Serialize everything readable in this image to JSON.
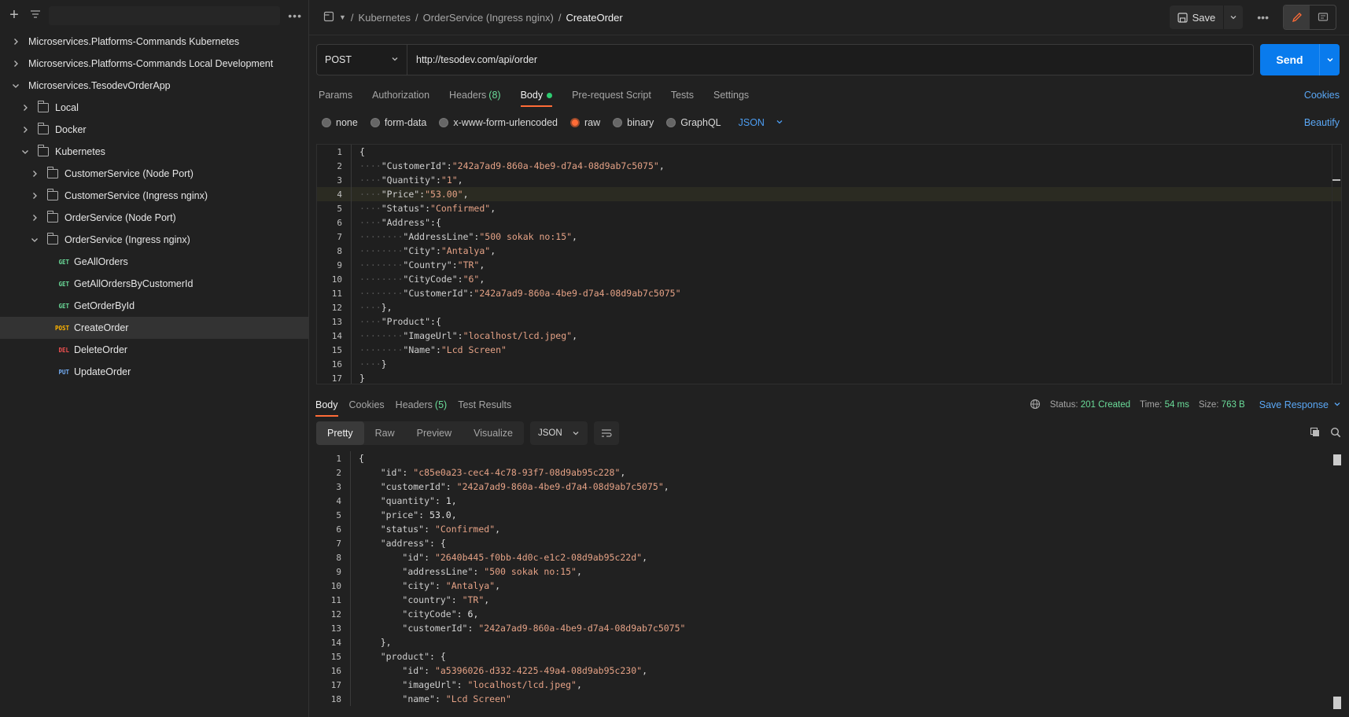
{
  "sidebar": {
    "filter_placeholder": "",
    "tree": [
      {
        "level": 0,
        "type": "collection",
        "expanded": false,
        "label": "Microservices.Platforms-Commands Kubernetes"
      },
      {
        "level": 0,
        "type": "collection",
        "expanded": false,
        "label": "Microservices.Platforms-Commands Local Development"
      },
      {
        "level": 0,
        "type": "collection",
        "expanded": true,
        "label": "Microservices.TesodevOrderApp"
      },
      {
        "level": 1,
        "type": "folder",
        "expanded": false,
        "label": "Local"
      },
      {
        "level": 1,
        "type": "folder",
        "expanded": false,
        "label": "Docker"
      },
      {
        "level": 1,
        "type": "folder",
        "expanded": true,
        "label": "Kubernetes"
      },
      {
        "level": 2,
        "type": "folder",
        "expanded": false,
        "label": "CustomerService (Node Port)"
      },
      {
        "level": 2,
        "type": "folder",
        "expanded": false,
        "label": "CustomerService (Ingress nginx)"
      },
      {
        "level": 2,
        "type": "folder",
        "expanded": false,
        "label": "OrderService (Node Port)"
      },
      {
        "level": 2,
        "type": "folder",
        "expanded": true,
        "label": "OrderService (Ingress nginx)"
      },
      {
        "level": 3,
        "type": "request",
        "method": "GET",
        "label": "GeAllOrders"
      },
      {
        "level": 3,
        "type": "request",
        "method": "GET",
        "label": "GetAllOrdersByCustomerId"
      },
      {
        "level": 3,
        "type": "request",
        "method": "GET",
        "label": "GetOrderById"
      },
      {
        "level": 3,
        "type": "request",
        "method": "POST",
        "label": "CreateOrder",
        "active": true
      },
      {
        "level": 3,
        "type": "request",
        "method": "DEL",
        "label": "DeleteOrder"
      },
      {
        "level": 3,
        "type": "request",
        "method": "PUT",
        "label": "UpdateOrder"
      }
    ]
  },
  "header": {
    "breadcrumb": [
      "Kubernetes",
      "OrderService (Ingress nginx)"
    ],
    "current": "CreateOrder",
    "sep": "/",
    "save_label": "Save"
  },
  "request": {
    "method": "POST",
    "url": "http://tesodev.com/api/order",
    "send_label": "Send",
    "tabs": [
      {
        "label": "Params"
      },
      {
        "label": "Authorization"
      },
      {
        "label": "Headers",
        "count": "(8)"
      },
      {
        "label": "Body",
        "active": true,
        "dot": true
      },
      {
        "label": "Pre-request Script"
      },
      {
        "label": "Tests"
      },
      {
        "label": "Settings"
      }
    ],
    "cookies_label": "Cookies",
    "body_types": [
      {
        "label": "none"
      },
      {
        "label": "form-data"
      },
      {
        "label": "x-www-form-urlencoded"
      },
      {
        "label": "raw",
        "selected": true
      },
      {
        "label": "binary"
      },
      {
        "label": "GraphQL"
      }
    ],
    "format": "JSON",
    "beautify_label": "Beautify",
    "body_lines": [
      {
        "n": "1",
        "indent": 0,
        "parts": [
          [
            "p",
            "{"
          ]
        ]
      },
      {
        "n": "2",
        "indent": 1,
        "parts": [
          [
            "k",
            "\"CustomerId\""
          ],
          [
            "p",
            ":"
          ],
          [
            "s",
            "\"242a7ad9-860a-4be9-d7a4-08d9ab7c5075\""
          ],
          [
            "p",
            ","
          ]
        ]
      },
      {
        "n": "3",
        "indent": 1,
        "parts": [
          [
            "k",
            "\"Quantity\""
          ],
          [
            "p",
            ":"
          ],
          [
            "s",
            "\"1\""
          ],
          [
            "p",
            ","
          ]
        ]
      },
      {
        "n": "4",
        "indent": 1,
        "hl": true,
        "parts": [
          [
            "k",
            "\"Price\""
          ],
          [
            "p",
            ":"
          ],
          [
            "s",
            "\"53.00\""
          ],
          [
            "p",
            ","
          ]
        ]
      },
      {
        "n": "5",
        "indent": 1,
        "parts": [
          [
            "k",
            "\"Status\""
          ],
          [
            "p",
            ":"
          ],
          [
            "s",
            "\"Confirmed\""
          ],
          [
            "p",
            ","
          ]
        ]
      },
      {
        "n": "6",
        "indent": 1,
        "parts": [
          [
            "k",
            "\"Address\""
          ],
          [
            "p",
            ":{"
          ]
        ]
      },
      {
        "n": "7",
        "indent": 2,
        "parts": [
          [
            "k",
            "\"AddressLine\""
          ],
          [
            "p",
            ":"
          ],
          [
            "s",
            "\"500 sokak no:15\""
          ],
          [
            "p",
            ","
          ]
        ]
      },
      {
        "n": "8",
        "indent": 2,
        "parts": [
          [
            "k",
            "\"City\""
          ],
          [
            "p",
            ":"
          ],
          [
            "s",
            "\"Antalya\""
          ],
          [
            "p",
            ","
          ]
        ]
      },
      {
        "n": "9",
        "indent": 2,
        "parts": [
          [
            "k",
            "\"Country\""
          ],
          [
            "p",
            ":"
          ],
          [
            "s",
            "\"TR\""
          ],
          [
            "p",
            ","
          ]
        ]
      },
      {
        "n": "10",
        "indent": 2,
        "parts": [
          [
            "k",
            "\"CityCode\""
          ],
          [
            "p",
            ":"
          ],
          [
            "s",
            "\"6\""
          ],
          [
            "p",
            ","
          ]
        ]
      },
      {
        "n": "11",
        "indent": 2,
        "parts": [
          [
            "k",
            "\"CustomerId\""
          ],
          [
            "p",
            ":"
          ],
          [
            "s",
            "\"242a7ad9-860a-4be9-d7a4-08d9ab7c5075\""
          ]
        ]
      },
      {
        "n": "12",
        "indent": 1,
        "parts": [
          [
            "p",
            "},"
          ]
        ]
      },
      {
        "n": "13",
        "indent": 1,
        "parts": [
          [
            "k",
            "\"Product\""
          ],
          [
            "p",
            ":{"
          ]
        ]
      },
      {
        "n": "14",
        "indent": 2,
        "parts": [
          [
            "k",
            "\"ImageUrl\""
          ],
          [
            "p",
            ":"
          ],
          [
            "s",
            "\"localhost/lcd.jpeg\""
          ],
          [
            "p",
            ","
          ]
        ]
      },
      {
        "n": "15",
        "indent": 2,
        "parts": [
          [
            "k",
            "\"Name\""
          ],
          [
            "p",
            ":"
          ],
          [
            "s",
            "\"Lcd Screen\""
          ]
        ]
      },
      {
        "n": "16",
        "indent": 1,
        "parts": [
          [
            "p",
            "}"
          ]
        ]
      },
      {
        "n": "17",
        "indent": 0,
        "parts": [
          [
            "p",
            "}"
          ]
        ]
      }
    ]
  },
  "response": {
    "tabs": [
      {
        "label": "Body",
        "active": true
      },
      {
        "label": "Cookies"
      },
      {
        "label": "Headers",
        "count": "(5)"
      },
      {
        "label": "Test Results"
      }
    ],
    "status_label": "Status:",
    "status_value": "201 Created",
    "time_label": "Time:",
    "time_value": "54 ms",
    "size_label": "Size:",
    "size_value": "763 B",
    "save_response_label": "Save Response",
    "views": [
      {
        "label": "Pretty",
        "active": true
      },
      {
        "label": "Raw"
      },
      {
        "label": "Preview"
      },
      {
        "label": "Visualize"
      }
    ],
    "format": "JSON",
    "body_lines": [
      {
        "n": "1",
        "indent": 0,
        "parts": [
          [
            "p",
            "{"
          ]
        ]
      },
      {
        "n": "2",
        "indent": 1,
        "parts": [
          [
            "k",
            "\"id\""
          ],
          [
            "p",
            ": "
          ],
          [
            "s",
            "\"c85e0a23-cec4-4c78-93f7-08d9ab95c228\""
          ],
          [
            "p",
            ","
          ]
        ]
      },
      {
        "n": "3",
        "indent": 1,
        "parts": [
          [
            "k",
            "\"customerId\""
          ],
          [
            "p",
            ": "
          ],
          [
            "s",
            "\"242a7ad9-860a-4be9-d7a4-08d9ab7c5075\""
          ],
          [
            "p",
            ","
          ]
        ]
      },
      {
        "n": "4",
        "indent": 1,
        "parts": [
          [
            "k",
            "\"quantity\""
          ],
          [
            "p",
            ": "
          ],
          [
            "n",
            "1"
          ],
          [
            "p",
            ","
          ]
        ]
      },
      {
        "n": "5",
        "indent": 1,
        "parts": [
          [
            "k",
            "\"price\""
          ],
          [
            "p",
            ": "
          ],
          [
            "n",
            "53.0"
          ],
          [
            "p",
            ","
          ]
        ]
      },
      {
        "n": "6",
        "indent": 1,
        "parts": [
          [
            "k",
            "\"status\""
          ],
          [
            "p",
            ": "
          ],
          [
            "s",
            "\"Confirmed\""
          ],
          [
            "p",
            ","
          ]
        ]
      },
      {
        "n": "7",
        "indent": 1,
        "parts": [
          [
            "k",
            "\"address\""
          ],
          [
            "p",
            ": {"
          ]
        ]
      },
      {
        "n": "8",
        "indent": 2,
        "parts": [
          [
            "k",
            "\"id\""
          ],
          [
            "p",
            ": "
          ],
          [
            "s",
            "\"2640b445-f0bb-4d0c-e1c2-08d9ab95c22d\""
          ],
          [
            "p",
            ","
          ]
        ]
      },
      {
        "n": "9",
        "indent": 2,
        "parts": [
          [
            "k",
            "\"addressLine\""
          ],
          [
            "p",
            ": "
          ],
          [
            "s",
            "\"500 sokak no:15\""
          ],
          [
            "p",
            ","
          ]
        ]
      },
      {
        "n": "10",
        "indent": 2,
        "parts": [
          [
            "k",
            "\"city\""
          ],
          [
            "p",
            ": "
          ],
          [
            "s",
            "\"Antalya\""
          ],
          [
            "p",
            ","
          ]
        ]
      },
      {
        "n": "11",
        "indent": 2,
        "parts": [
          [
            "k",
            "\"country\""
          ],
          [
            "p",
            ": "
          ],
          [
            "s",
            "\"TR\""
          ],
          [
            "p",
            ","
          ]
        ]
      },
      {
        "n": "12",
        "indent": 2,
        "parts": [
          [
            "k",
            "\"cityCode\""
          ],
          [
            "p",
            ": "
          ],
          [
            "n",
            "6"
          ],
          [
            "p",
            ","
          ]
        ]
      },
      {
        "n": "13",
        "indent": 2,
        "parts": [
          [
            "k",
            "\"customerId\""
          ],
          [
            "p",
            ": "
          ],
          [
            "s",
            "\"242a7ad9-860a-4be9-d7a4-08d9ab7c5075\""
          ]
        ]
      },
      {
        "n": "14",
        "indent": 1,
        "parts": [
          [
            "p",
            "},"
          ]
        ]
      },
      {
        "n": "15",
        "indent": 1,
        "parts": [
          [
            "k",
            "\"product\""
          ],
          [
            "p",
            ": {"
          ]
        ]
      },
      {
        "n": "16",
        "indent": 2,
        "parts": [
          [
            "k",
            "\"id\""
          ],
          [
            "p",
            ": "
          ],
          [
            "s",
            "\"a5396026-d332-4225-49a4-08d9ab95c230\""
          ],
          [
            "p",
            ","
          ]
        ]
      },
      {
        "n": "17",
        "indent": 2,
        "parts": [
          [
            "k",
            "\"imageUrl\""
          ],
          [
            "p",
            ": "
          ],
          [
            "s",
            "\"localhost/lcd.jpeg\""
          ],
          [
            "p",
            ","
          ]
        ]
      },
      {
        "n": "18",
        "indent": 2,
        "parts": [
          [
            "k",
            "\"name\""
          ],
          [
            "p",
            ": "
          ],
          [
            "s",
            "\"Lcd Screen\""
          ]
        ]
      }
    ]
  }
}
